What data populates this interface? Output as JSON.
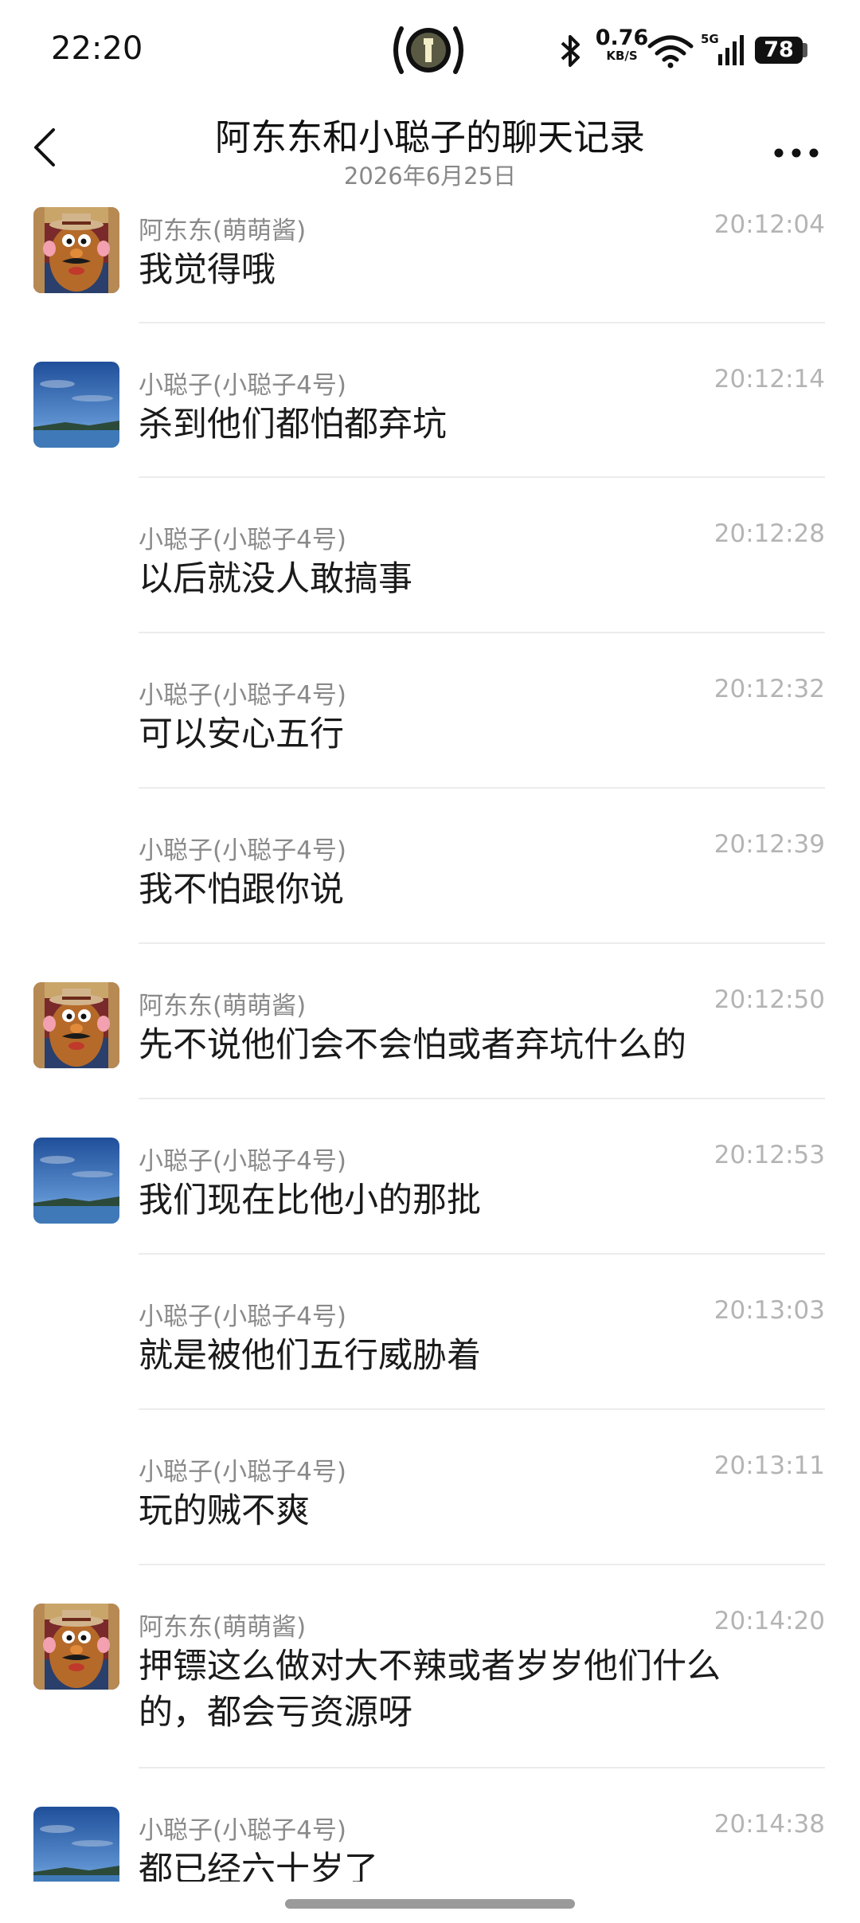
{
  "status_bar": {
    "time": "22:20",
    "net_speed": "0.76",
    "net_unit": "KB/S",
    "network": "5G",
    "battery": "78",
    "icons": [
      "flashlight-icon",
      "bluetooth-icon",
      "wifi-icon",
      "cellular-signal-icon",
      "battery-icon"
    ]
  },
  "header": {
    "title": "阿东东和小聪子的聊天记录",
    "subtitle": "2026年6月25日",
    "icons": [
      "back-chevron-icon",
      "more-dots-icon"
    ]
  },
  "messages": [
    {
      "sender": "阿东东(萌萌酱)",
      "time": "20:12:04",
      "text": "我觉得哦",
      "avatar": "potato-head"
    },
    {
      "sender": "小聪子(小聪子4号)",
      "time": "20:12:14",
      "text": "杀到他们都怕都弃坑",
      "avatar": "lake-sky"
    },
    {
      "sender": "小聪子(小聪子4号)",
      "time": "20:12:28",
      "text": "以后就没人敢搞事",
      "avatar": ""
    },
    {
      "sender": "小聪子(小聪子4号)",
      "time": "20:12:32",
      "text": "可以安心五行",
      "avatar": ""
    },
    {
      "sender": "小聪子(小聪子4号)",
      "time": "20:12:39",
      "text": "我不怕跟你说",
      "avatar": ""
    },
    {
      "sender": "阿东东(萌萌酱)",
      "time": "20:12:50",
      "text": "先不说他们会不会怕或者弃坑什么的",
      "avatar": "potato-head"
    },
    {
      "sender": "小聪子(小聪子4号)",
      "time": "20:12:53",
      "text": "我们现在比他小的那批",
      "avatar": "lake-sky"
    },
    {
      "sender": "小聪子(小聪子4号)",
      "time": "20:13:03",
      "text": "就是被他们五行威胁着",
      "avatar": ""
    },
    {
      "sender": "小聪子(小聪子4号)",
      "time": "20:13:11",
      "text": "玩的贼不爽",
      "avatar": ""
    },
    {
      "sender": "阿东东(萌萌酱)",
      "time": "20:14:20",
      "text": "押镖这么做对大不辣或者岁岁他们什么的，都会亏资源呀",
      "avatar": "potato-head"
    },
    {
      "sender": "小聪子(小聪子4号)",
      "time": "20:14:38",
      "text": "都已经六十岁了",
      "avatar": "lake-sky"
    }
  ]
}
